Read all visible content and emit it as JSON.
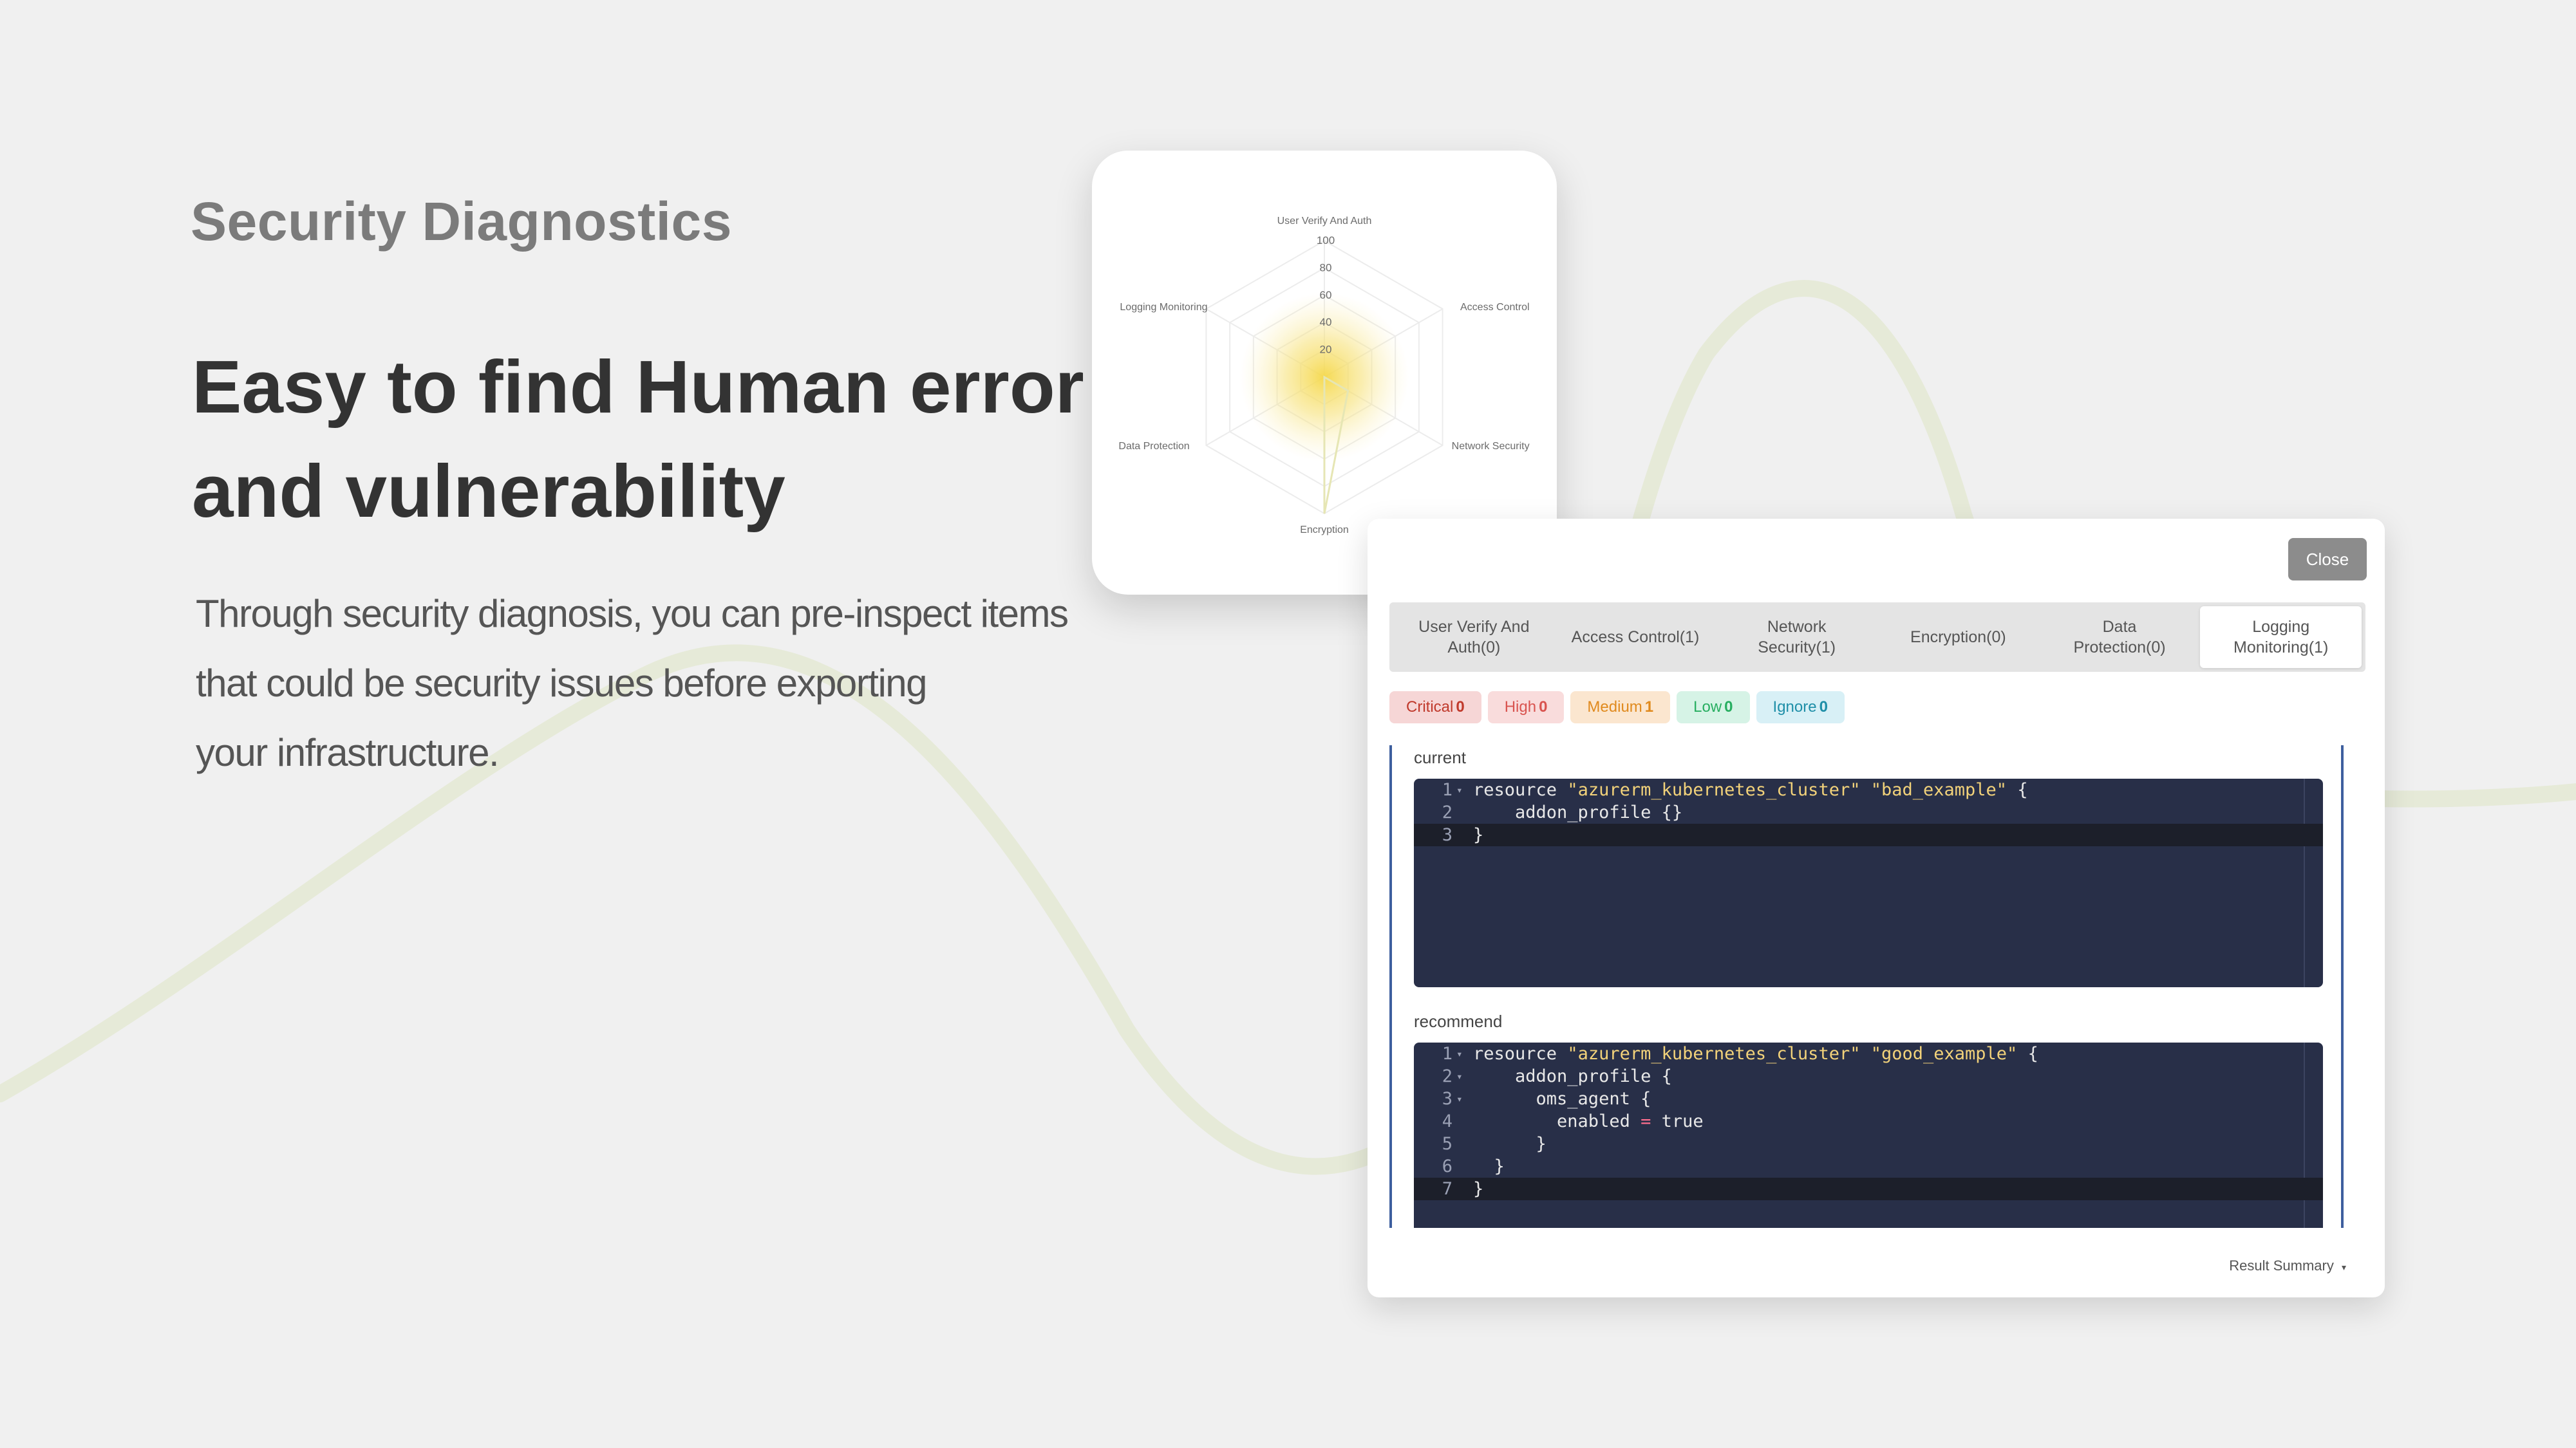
{
  "hero": {
    "eyebrow": "Security Diagnostics",
    "headline_line1": "Easy to find Human error",
    "headline_line2": "and vulnerability",
    "desc_line1": "Through security diagnosis, you can pre-inspect items",
    "desc_line2": "that could be security issues before exporting",
    "desc_line3": "your infrastructure."
  },
  "radar": {
    "axes": [
      "User Verify And Auth",
      "Access Control",
      "Network Security",
      "Encryption",
      "Data Protection",
      "Logging Monitoring"
    ],
    "ticks": [
      "100",
      "80",
      "60",
      "40",
      "20"
    ],
    "values": [
      0,
      0,
      20,
      100,
      0,
      0
    ],
    "max": 100,
    "accent": "#f5d84a",
    "grid_color": "#ececec",
    "series_color": "#e6e6b4"
  },
  "dialog": {
    "close_label": "Close",
    "tabs": [
      {
        "line1": "User Verify And",
        "line2": "Auth(0)"
      },
      {
        "line1": "Access Control(1)",
        "line2": ""
      },
      {
        "line1": "Network",
        "line2": "Security(1)"
      },
      {
        "line1": "Encryption(0)",
        "line2": ""
      },
      {
        "line1": "Data",
        "line2": "Protection(0)"
      },
      {
        "line1": "Logging",
        "line2": "Monitoring(1)"
      }
    ],
    "badges": [
      {
        "label": "Critical",
        "count": "0",
        "bg": "#f6d6d6",
        "color": "#c0392b"
      },
      {
        "label": "High",
        "count": "0",
        "bg": "#f9dcdc",
        "color": "#d9534f"
      },
      {
        "label": "Medium",
        "count": "1",
        "bg": "#fbe6cf",
        "color": "#e08a1e"
      },
      {
        "label": "Low",
        "count": "0",
        "bg": "#d6f3e6",
        "color": "#27ae60"
      },
      {
        "label": "Ignore",
        "count": "0",
        "bg": "#d8f0f6",
        "color": "#1f8fa8"
      }
    ],
    "current_label": "current",
    "recommend_label": "recommend",
    "current_code": [
      {
        "num": "1",
        "fold": "▾",
        "pre": "resource ",
        "s1": "\"azurerm_kubernetes_cluster\"",
        "mid": " ",
        "s2": "\"bad_example\"",
        "post": " {"
      },
      {
        "num": "2",
        "fold": "",
        "pre": "    addon_profile {}",
        "s1": "",
        "mid": "",
        "s2": "",
        "post": ""
      },
      {
        "num": "3",
        "fold": "",
        "pre": "}",
        "s1": "",
        "mid": "",
        "s2": "",
        "post": ""
      }
    ],
    "recommend_code": [
      {
        "num": "1",
        "fold": "▾",
        "pre": "resource ",
        "s1": "\"azurerm_kubernetes_cluster\"",
        "mid": " ",
        "s2": "\"good_example\"",
        "post": " {"
      },
      {
        "num": "2",
        "fold": "▾",
        "pre": "    addon_profile {",
        "s1": "",
        "mid": "",
        "s2": "",
        "post": ""
      },
      {
        "num": "3",
        "fold": "▾",
        "pre": "      oms_agent {",
        "s1": "",
        "mid": "",
        "s2": "",
        "post": ""
      },
      {
        "num": "4",
        "fold": "",
        "pre": "        enabled ",
        "op": "=",
        "tail": " true"
      },
      {
        "num": "5",
        "fold": "",
        "pre": "      }",
        "s1": "",
        "mid": "",
        "s2": "",
        "post": ""
      },
      {
        "num": "6",
        "fold": "",
        "pre": "  }",
        "s1": "",
        "mid": "",
        "s2": "",
        "post": ""
      },
      {
        "num": "7",
        "fold": "",
        "pre": "}",
        "s1": "",
        "mid": "",
        "s2": "",
        "post": ""
      }
    ],
    "result_summary": "Result Summary",
    "result_summary_icon": "caret-down-icon"
  }
}
